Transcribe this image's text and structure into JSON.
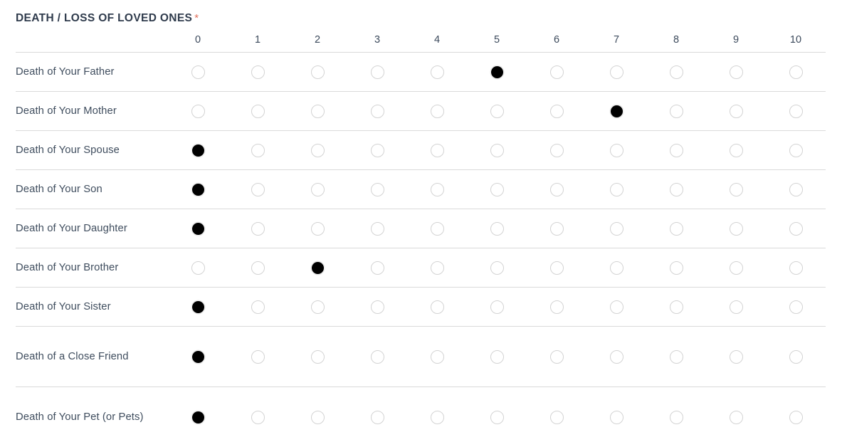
{
  "question": {
    "title": "DEATH / LOSS OF LOVED ONES",
    "required_marker": "*",
    "required": true
  },
  "matrix": {
    "label_column_header": "",
    "scale_headers": [
      "0",
      "1",
      "2",
      "3",
      "4",
      "5",
      "6",
      "7",
      "8",
      "9",
      "10"
    ],
    "rows": [
      {
        "label": "Death of Your Father",
        "selected": 5
      },
      {
        "label": "Death of Your Mother",
        "selected": 7
      },
      {
        "label": "Death of Your Spouse",
        "selected": 0
      },
      {
        "label": "Death of Your Son",
        "selected": 0
      },
      {
        "label": "Death of Your Daughter",
        "selected": 0
      },
      {
        "label": "Death of Your Brother",
        "selected": 2
      },
      {
        "label": "Death of Your Sister",
        "selected": 0
      },
      {
        "label": "Death of a Close Friend",
        "selected": 0
      },
      {
        "label": "Death of Your Pet (or Pets)",
        "selected": 0
      }
    ]
  },
  "colors": {
    "title": "#2f3b4c",
    "asterisk": "#e0705c",
    "row_label": "#3f4d5e",
    "header_label": "#3c4a5c",
    "row_divider": "#dadada",
    "radio_border": "#d3d3d3",
    "radio_selected": "#000000",
    "background": "#ffffff"
  }
}
